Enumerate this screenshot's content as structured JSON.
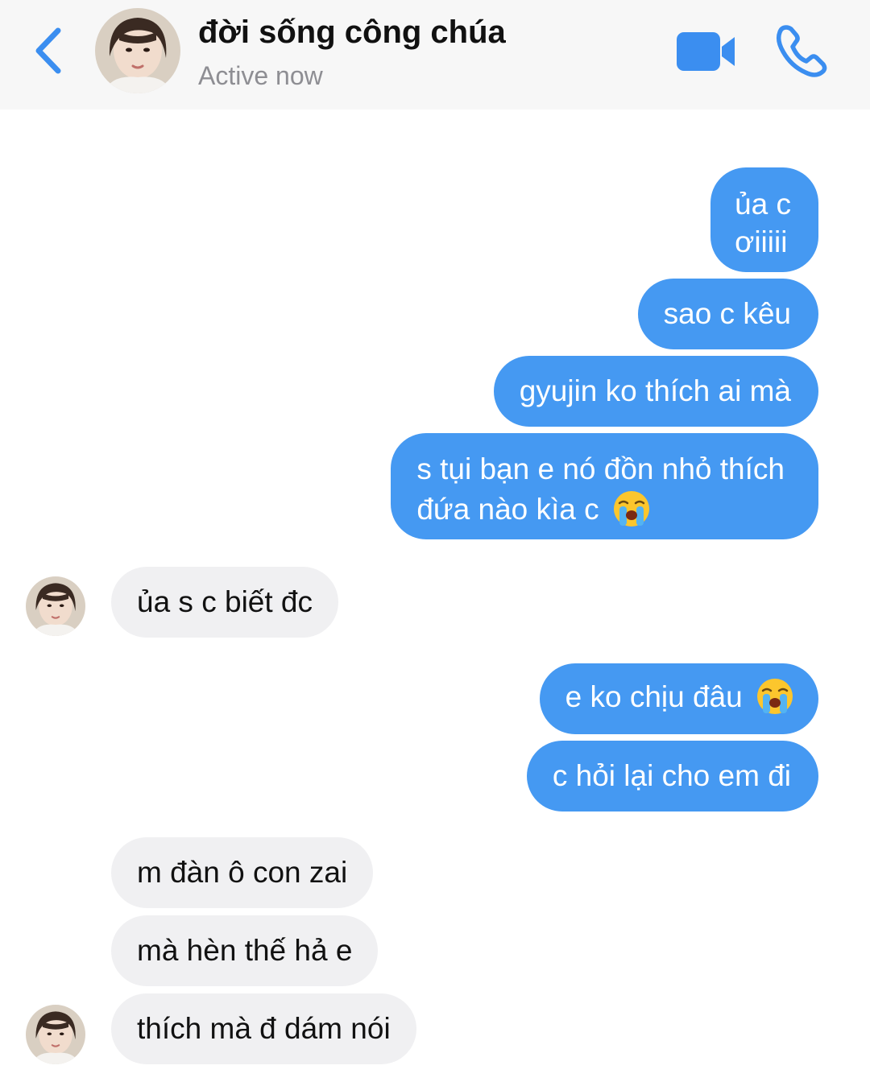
{
  "header": {
    "title": "đời sống công chúa",
    "status": "Active now"
  },
  "icons": {
    "back": "chevron-left-icon",
    "video": "video-camera-icon",
    "phone": "phone-icon",
    "emoji": "loudly-crying-face-emoji"
  },
  "colors": {
    "outgoing_bubble": "#4599f2",
    "incoming_bubble": "#f0f0f2",
    "accent": "#3b8ef0",
    "header_bg": "#f7f7f7"
  },
  "messages": [
    {
      "direction": "out",
      "lines": [
        "ủa c",
        "ơiiiii"
      ]
    },
    {
      "direction": "out",
      "text": "sao c kêu"
    },
    {
      "direction": "out",
      "text": "gyujin ko thích ai mà"
    },
    {
      "direction": "out",
      "lines": [
        "s tụi bạn e nó đồn nhỏ thích",
        "đứa nào kìa c"
      ],
      "emoji": "😭"
    },
    {
      "direction": "in",
      "text": "ủa s c biết đc"
    },
    {
      "direction": "out",
      "text": "e ko chịu đâu",
      "emoji": "😭"
    },
    {
      "direction": "out",
      "text": "c hỏi lại cho em đi"
    },
    {
      "direction": "in",
      "text": "m đàn ô con zai"
    },
    {
      "direction": "in",
      "text": "mà hèn thế hả e"
    },
    {
      "direction": "in",
      "text": "thích mà đ dám nói"
    }
  ]
}
